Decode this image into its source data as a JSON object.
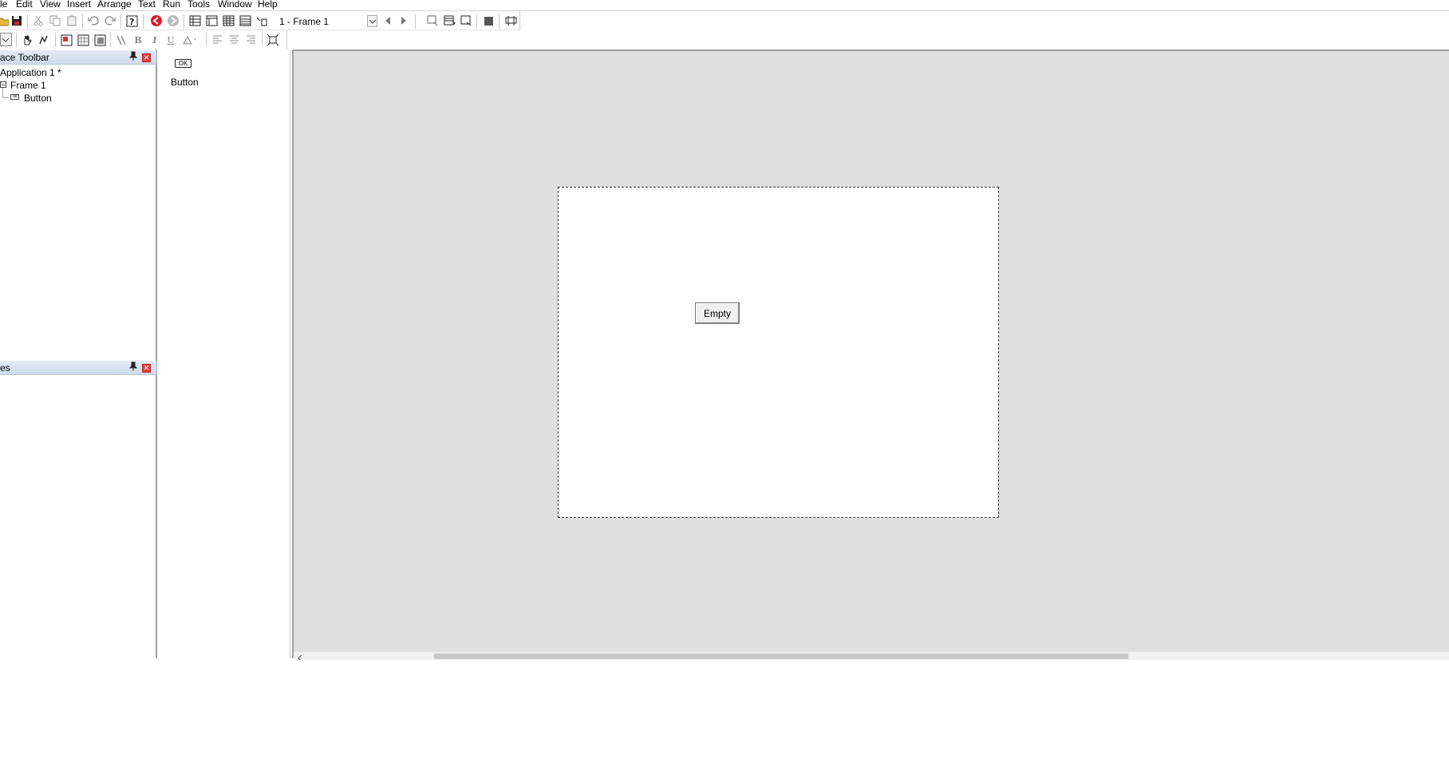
{
  "menu": [
    "le",
    "Edit",
    "View",
    "Insert",
    "Arrange",
    "Text",
    "Run",
    "Tools",
    "Window",
    "Help"
  ],
  "frame_select": {
    "value": "1 - Frame 1"
  },
  "panels": {
    "top": {
      "title": "ace Toolbar"
    },
    "bottom": {
      "title": "es"
    }
  },
  "tree": {
    "app": "Application 1 *",
    "frame": "Frame 1",
    "button": "Button"
  },
  "palette": {
    "ok_icon_text": "OK",
    "button_label": "Button"
  },
  "canvas": {
    "button_label": "Empty"
  },
  "colors": {
    "canvas_bg": "#dfdfdf",
    "panel_header": "#cfdbea",
    "close_red": "#e0413c"
  }
}
